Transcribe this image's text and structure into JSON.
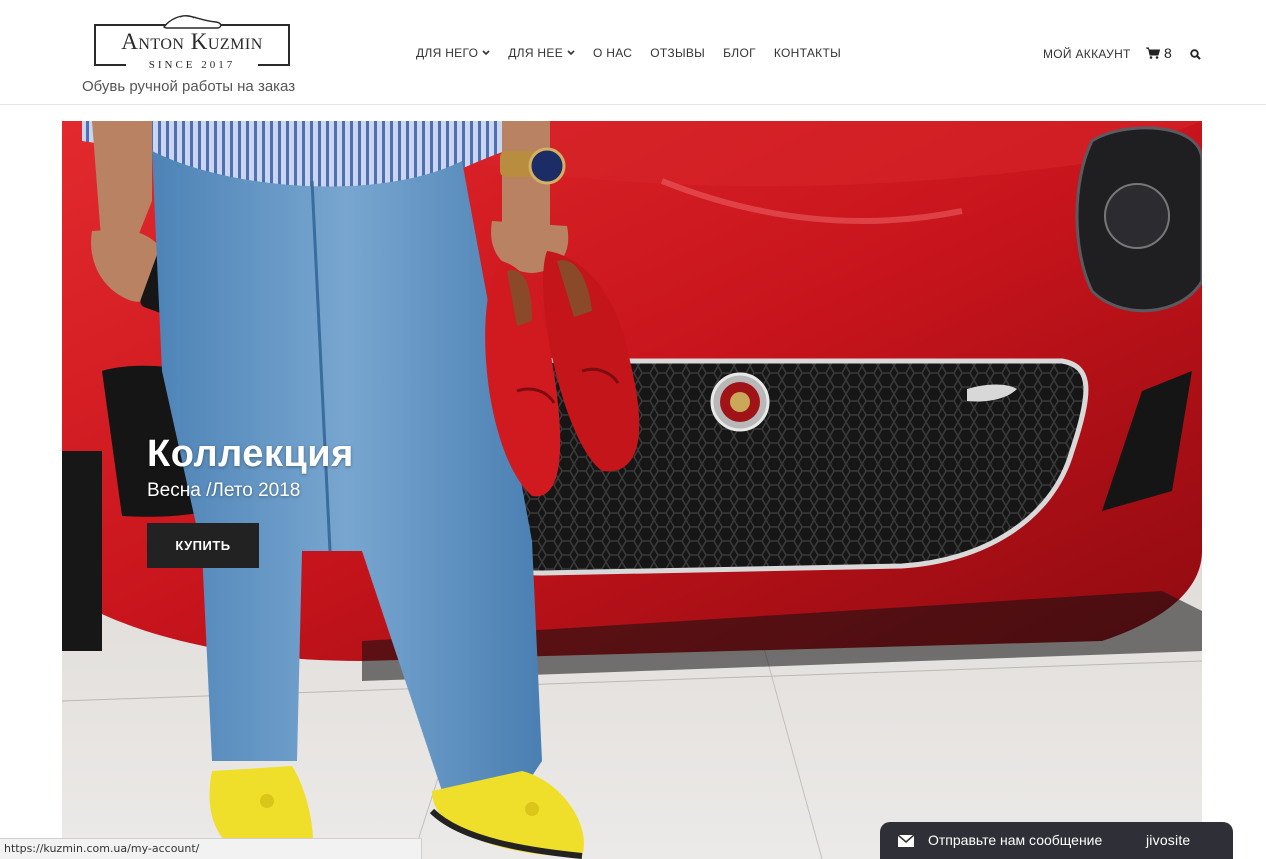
{
  "brand": {
    "name": "Anton Kuzmin",
    "since": "SINCE 2017",
    "tagline": "Обувь ручной работы на заказ"
  },
  "nav": {
    "items": [
      {
        "label": "ДЛЯ НЕГО",
        "dropdown": true
      },
      {
        "label": "ДЛЯ НЕЕ",
        "dropdown": true
      },
      {
        "label": "О НАС",
        "dropdown": false
      },
      {
        "label": "ОТЗЫВЫ",
        "dropdown": false
      },
      {
        "label": "БЛОГ",
        "dropdown": false
      },
      {
        "label": "КОНТАКТЫ",
        "dropdown": false
      }
    ],
    "account_label": "МОЙ АККАУНТ",
    "cart_count": "8",
    "cart_icon": "cart-icon",
    "search_icon": "search-icon"
  },
  "hero": {
    "title": "Коллекция",
    "subtitle": "Весна /Лето 2018",
    "button_label": "КУПИТЬ"
  },
  "status": {
    "url": "https://kuzmin.com.ua/my-account/"
  },
  "chat": {
    "message": "Отправьте нам сообщение",
    "brand": "jivosite"
  },
  "colors": {
    "car_red": "#c8141c",
    "dark": "#222222",
    "chat_bg": "#2f2f37"
  }
}
